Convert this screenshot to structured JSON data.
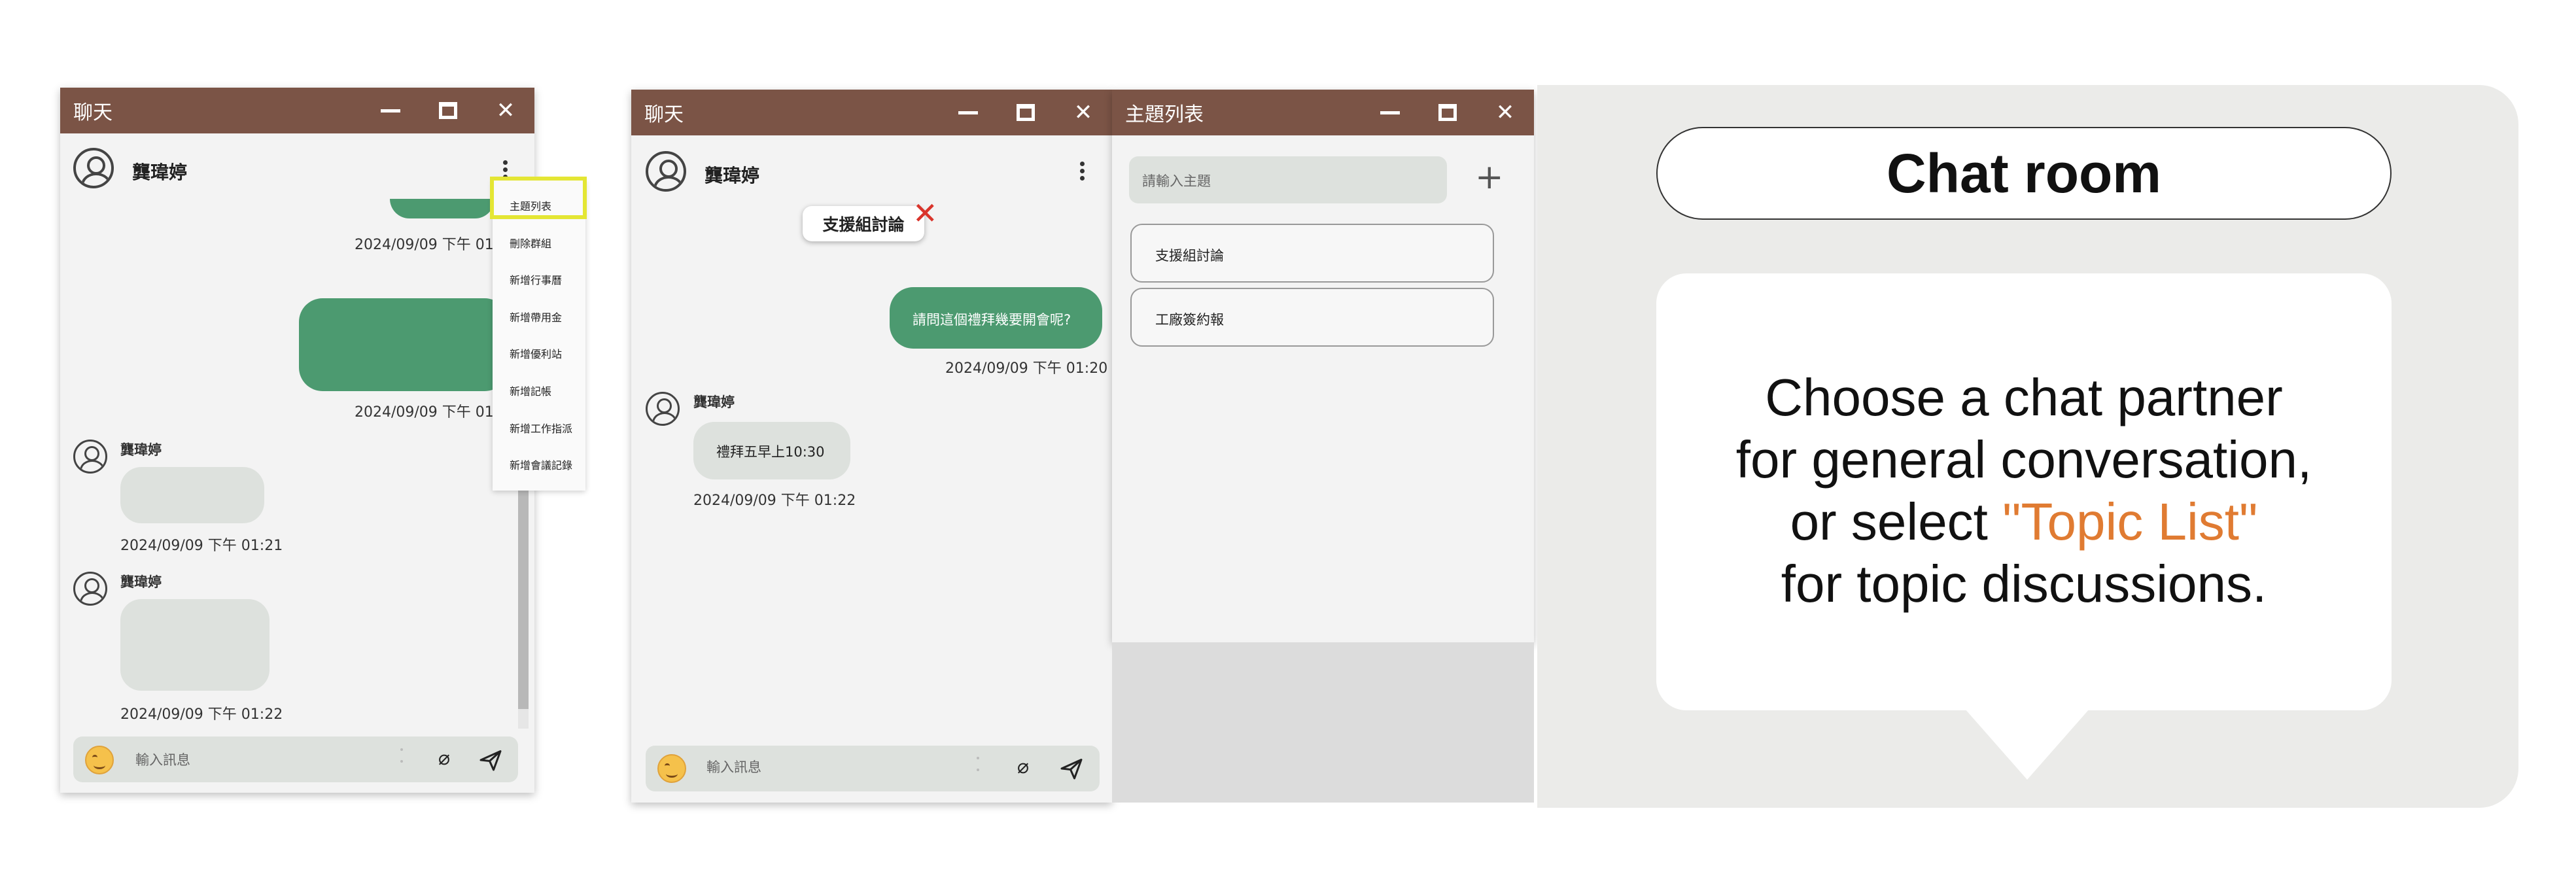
{
  "colors": {
    "titlebar": "#7b5446",
    "sent_bubble": "#4c9a70",
    "received_bubble": "#dde1dd",
    "highlight": "#e4e634",
    "close_x": "#d9342b",
    "accent": "#e07b32"
  },
  "left_window": {
    "title": "聊天",
    "contact_name": "龔瑋婷",
    "timestamps": [
      "2024/09/09 下午 01:1",
      "2024/09/09 下午 01:2",
      "2024/09/09 下午 01:21",
      "2024/09/09 下午 01:22"
    ],
    "sender_names": [
      "龔瑋婷",
      "龔瑋婷"
    ],
    "menu_items": [
      "主題列表",
      "刪除群組",
      "新增行事曆",
      "新增帶用金",
      "新增優利站",
      "新增記帳",
      "新增工作指派",
      "新增會議記錄"
    ],
    "input_placeholder": "輸入訊息"
  },
  "mid_window": {
    "title": "聊天",
    "contact_name": "龔瑋婷",
    "topic_chip": "支援組討論",
    "sent_message": "請問這個禮拜幾要開會呢?",
    "sent_time": "2024/09/09 下午 01:20",
    "sender_name": "龔瑋婷",
    "received_message": "禮拜五早上10:30",
    "received_time": "2024/09/09 下午 01:22",
    "input_placeholder": "輸入訊息"
  },
  "topic_window": {
    "title": "主題列表",
    "search_placeholder": "請輸入主題",
    "topics": [
      "支援組討論",
      "工廠簽約報"
    ]
  },
  "panel": {
    "heading": "Chat room",
    "line1": "Choose a chat partner",
    "line2": "for general conversation,",
    "line3_prefix": "or select ",
    "line3_accent": "\"Topic List\"",
    "line4": "for topic discussions."
  }
}
